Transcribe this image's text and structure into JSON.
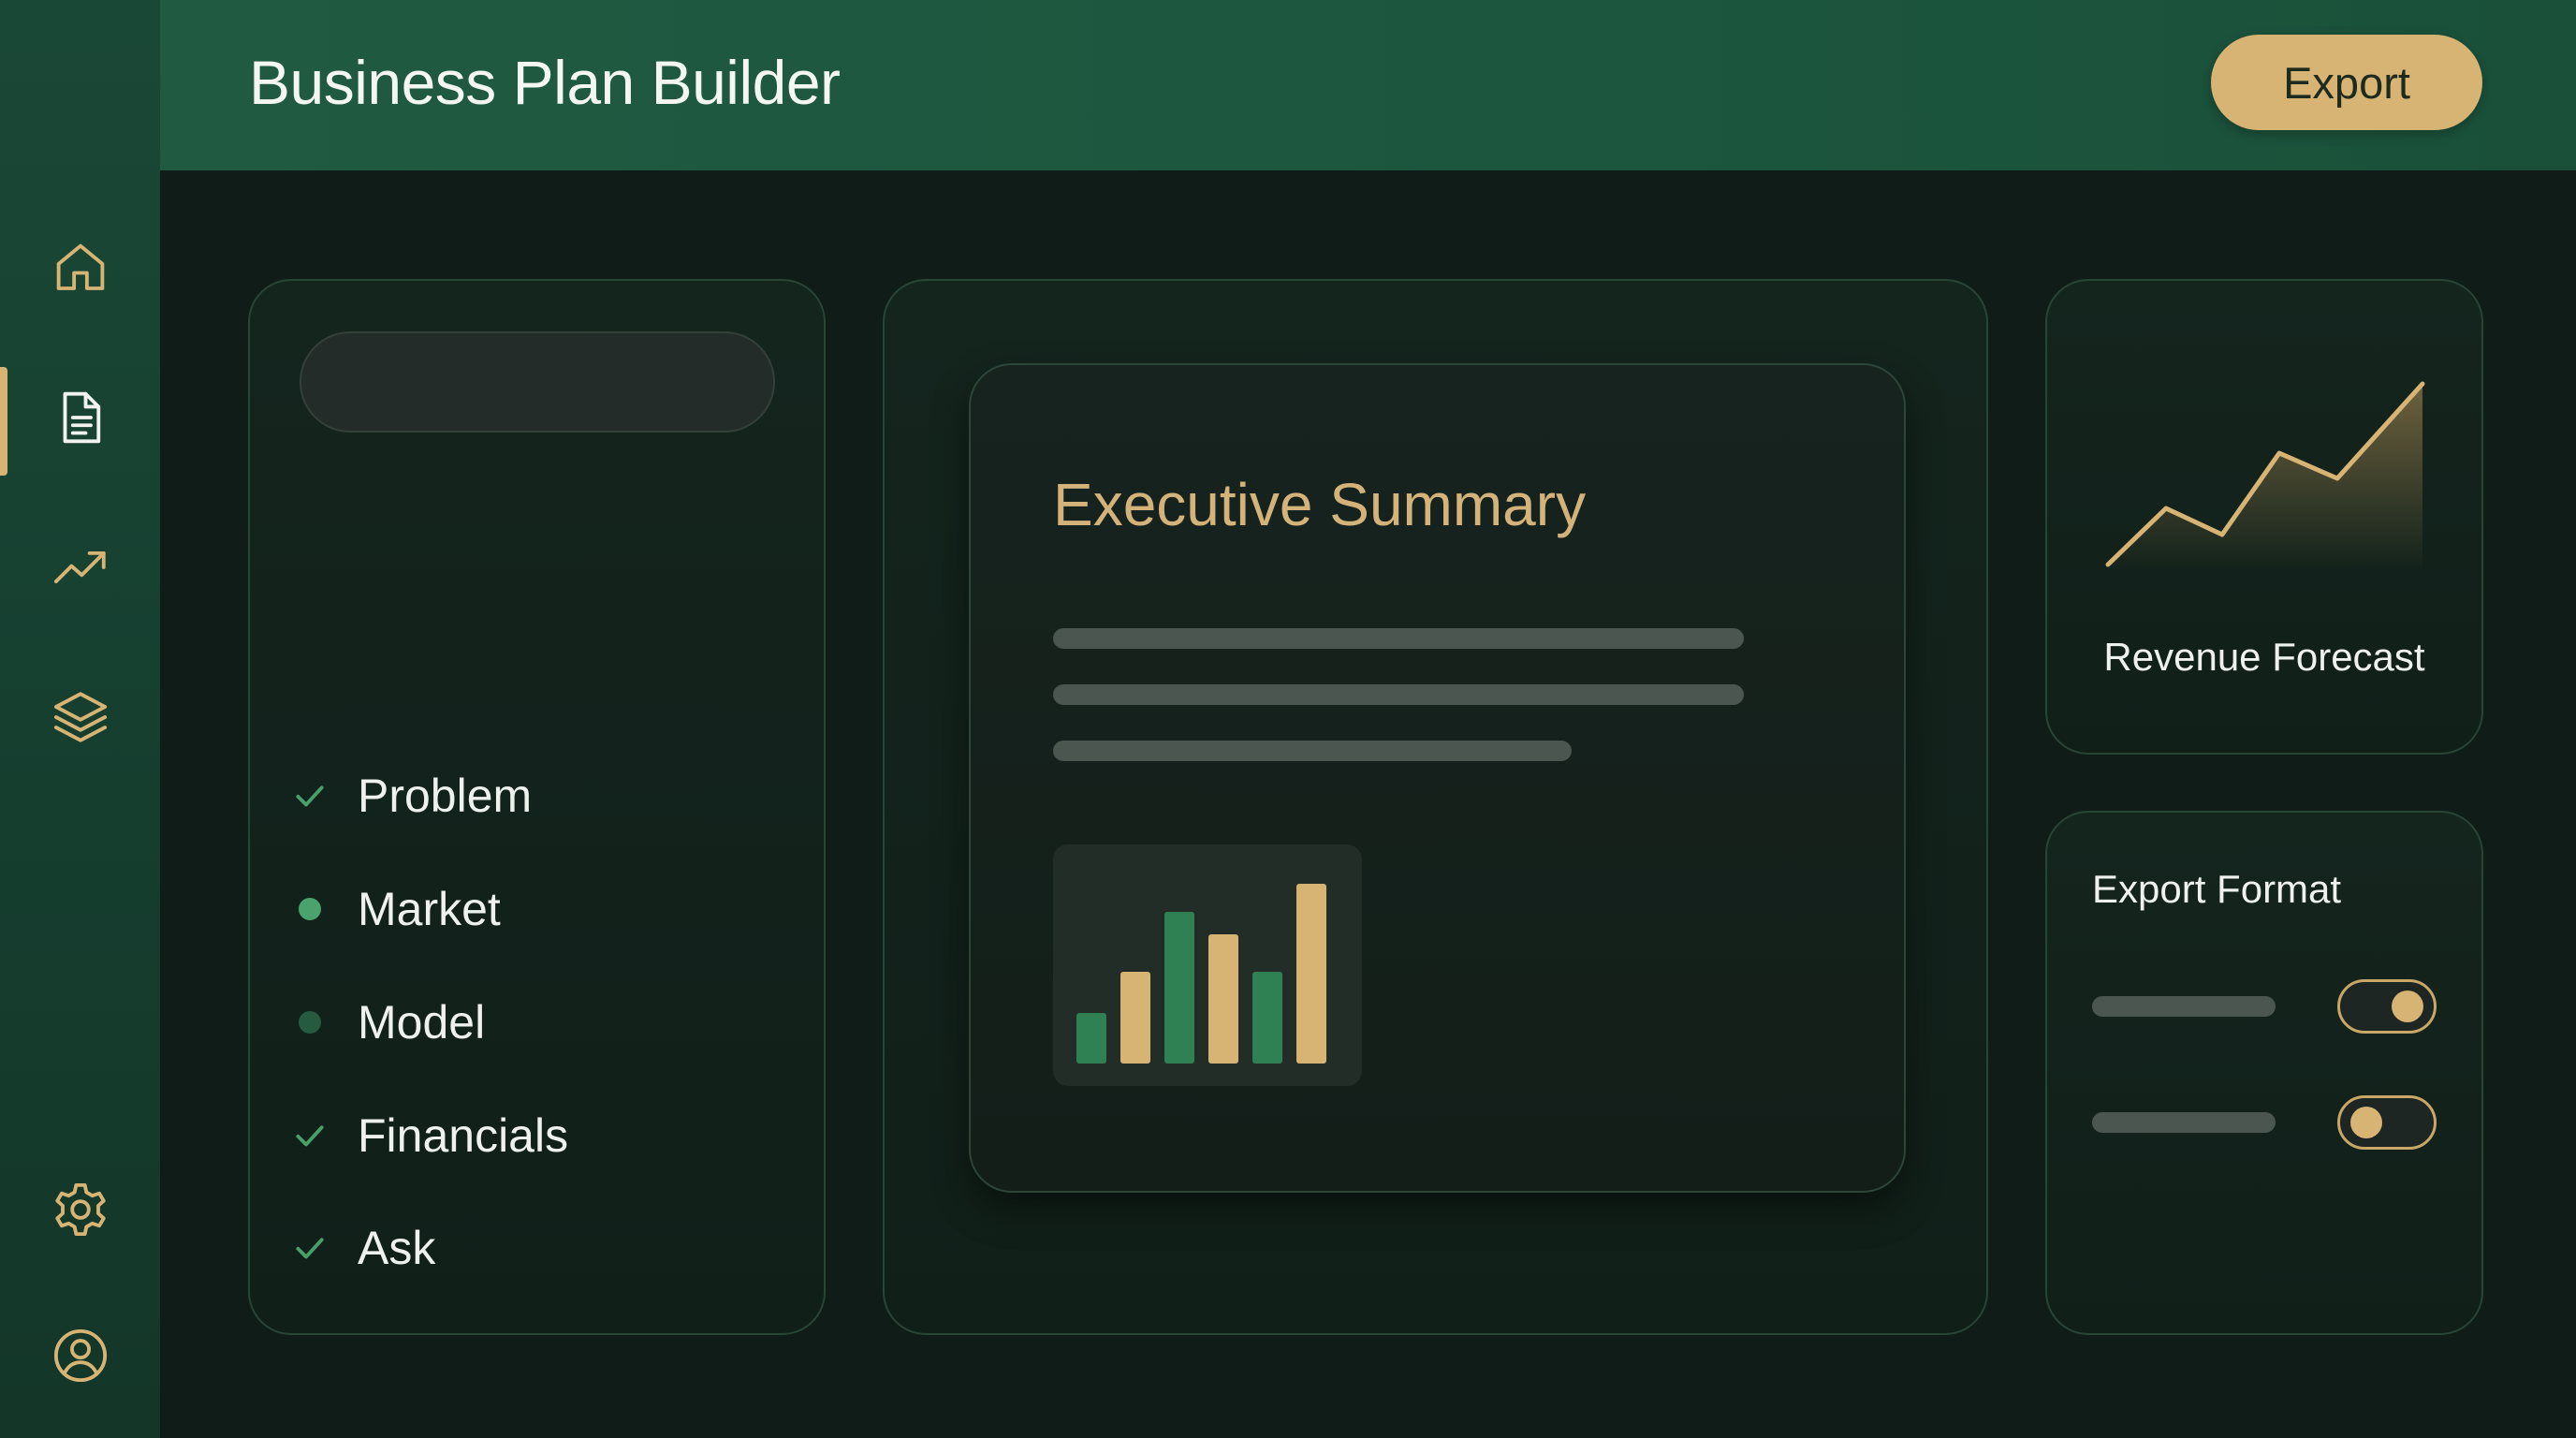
{
  "header": {
    "title": "Business Plan Builder",
    "export_label": "Export"
  },
  "sidebar": {
    "items": [
      {
        "icon": "home-icon"
      },
      {
        "icon": "document-icon",
        "active": true
      },
      {
        "icon": "trending-up-icon"
      },
      {
        "icon": "layers-icon"
      },
      {
        "icon": "gear-icon"
      },
      {
        "icon": "user-circle-icon"
      }
    ]
  },
  "outline": {
    "items": [
      {
        "label": "Problem",
        "status": "done"
      },
      {
        "label": "Market",
        "status": "active"
      },
      {
        "label": "Model",
        "status": "pending"
      },
      {
        "label": "Financials",
        "status": "done"
      },
      {
        "label": "Ask",
        "status": "done"
      }
    ]
  },
  "document": {
    "title": "Executive Summary"
  },
  "revenue": {
    "label": "Revenue Forecast"
  },
  "export_format": {
    "title": "Export Format",
    "toggles": [
      {
        "state": "on"
      },
      {
        "state": "off"
      }
    ]
  },
  "colors": {
    "accent_gold": "#d7b474",
    "accent_green": "#3d8b5e",
    "sidebar": "#1a4836",
    "header": "#1f5a41",
    "background": "#0f1c17"
  }
}
